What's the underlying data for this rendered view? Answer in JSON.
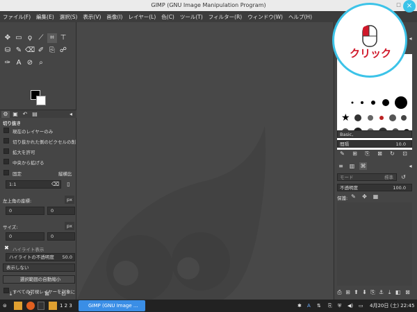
{
  "window": {
    "title": "GIMP (GNU Image Manipulation Program)",
    "minimize": "□",
    "close": "×"
  },
  "menu": [
    "ファイル(F)",
    "編集(E)",
    "選択(S)",
    "表示(V)",
    "画像(I)",
    "レイヤー(L)",
    "色(C)",
    "ツール(T)",
    "フィルター(R)",
    "ウィンドウ(W)",
    "ヘルプ(H)"
  ],
  "tool_options": {
    "section_title": "切り抜き",
    "checkboxes": [
      "現在のレイヤーのみ",
      "切り抜かれた側のピクセルの削",
      "拡大を許可",
      "中央から拡げる"
    ],
    "fixed_label": "固定",
    "fixed_mode": "縦横比",
    "ratio_value": "1:1",
    "position_label": "左上角の座標:",
    "position_unit": "px",
    "position_x": "0",
    "position_y": "0",
    "size_label": "サイズ:",
    "size_unit": "px",
    "size_w": "0",
    "size_h": "0",
    "highlight_label": "ハイライト表示",
    "highlight_opacity_label": "ハイライトの不透明度",
    "highlight_opacity_value": "50.0",
    "guides_value": "表示しない",
    "auto_shrink_label": "選択範囲の自動縮小",
    "all_layers_label": "すべての可視レイヤーを対象に"
  },
  "brushes": {
    "preset_label": "Basic,",
    "spacing_label": "間隔",
    "spacing_value": "10.0"
  },
  "layers": {
    "mode_label": "モード",
    "mode_value": "標準",
    "opacity_label": "不透明度",
    "opacity_value": "100.0",
    "lock_label": "保護:"
  },
  "callout": {
    "label": "クリック"
  },
  "taskbar": {
    "workspaces": "1 2 3",
    "task_label": "GIMP (GNU Image ...",
    "datetime": "4月20日 (土) 22:45",
    "input_indicator": "A"
  },
  "colors": {
    "menubar": "#3c3c3c",
    "panel": "#454545",
    "task_active": "#3a8ee6",
    "callout_border": "#3cc3e8",
    "callout_text": "#d0182a"
  }
}
